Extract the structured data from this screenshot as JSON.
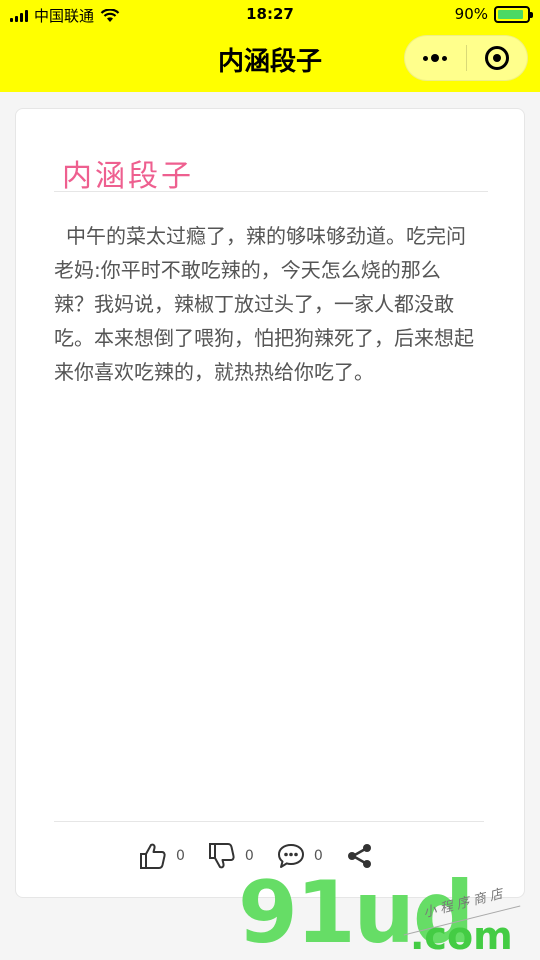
{
  "status_bar": {
    "carrier": "中国联通",
    "time": "18:27",
    "battery": "90%",
    "battery_level": 0.9
  },
  "nav": {
    "title": "内涵段子",
    "more_icon": "more-dots-icon",
    "close_icon": "target-close-icon"
  },
  "post": {
    "title": "内涵段子",
    "content": "中午的菜太过瘾了，辣的够味够劲道。吃完问老妈:你平时不敢吃辣的，今天怎么烧的那么辣？我妈说，辣椒丁放过头了，一家人都没敢吃。本来想倒了喂狗，怕把狗辣死了，后来想起来你喜欢吃辣的，就热热给你吃了。"
  },
  "actions": {
    "like_count": "0",
    "dislike_count": "0",
    "comment_count": "0",
    "share_icon": "share-icon"
  },
  "watermark": {
    "brand": "91ud",
    "domain": ".com",
    "tagline": "小程序商店"
  },
  "colors": {
    "header_bg": "#ffff00",
    "title_pink": "#ee5f8f",
    "watermark_green": "#66dd66"
  }
}
